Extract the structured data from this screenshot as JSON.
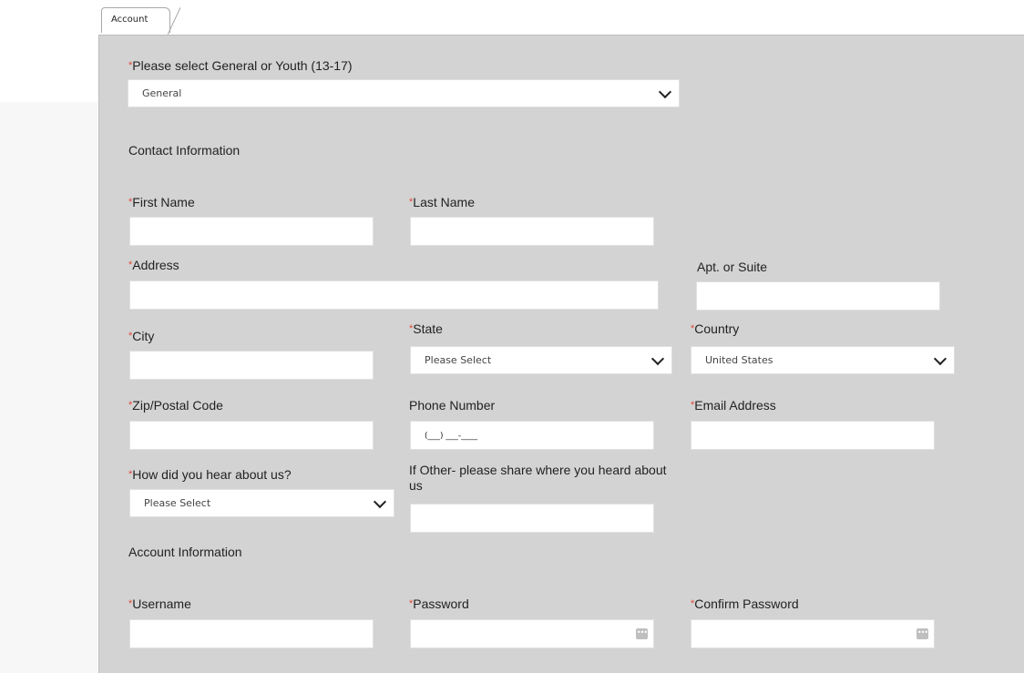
{
  "tab": {
    "label": "Account"
  },
  "membership": {
    "label": "Please select General or Youth (13-17)",
    "value": "General"
  },
  "sections": {
    "contact": "Contact Information",
    "account": "Account Information"
  },
  "fields": {
    "first_name": {
      "label": "First Name",
      "required": "*"
    },
    "last_name": {
      "label": "Last Name",
      "required": "*"
    },
    "address": {
      "label": "Address",
      "required": "*"
    },
    "apt": {
      "label": "Apt. or Suite"
    },
    "city": {
      "label": "City",
      "required": "*"
    },
    "state": {
      "label": "State",
      "required": "*",
      "value": "Please Select"
    },
    "country": {
      "label": "Country",
      "required": "*",
      "value": "United States"
    },
    "zip": {
      "label": "Zip/Postal Code",
      "required": "*"
    },
    "phone": {
      "label": "Phone Number",
      "value": "(___) ___-____"
    },
    "email": {
      "label": "Email Address",
      "required": "*"
    },
    "hear": {
      "label": "How did you hear about us?",
      "required": "*",
      "value": "Please Select"
    },
    "other": {
      "label": "If Other- please share where you heard about us"
    },
    "username": {
      "label": "Username",
      "required": "*"
    },
    "password": {
      "label": "Password",
      "required": "*"
    },
    "confirm": {
      "label": "Confirm Password",
      "required": "*"
    }
  },
  "icons": {
    "password_reveal": "ellipsis-icon",
    "dropdown": "chevron-down-icon"
  },
  "colors": {
    "panel": "#d3d3d3",
    "required": "#e2483d",
    "field": "#ffffff"
  }
}
